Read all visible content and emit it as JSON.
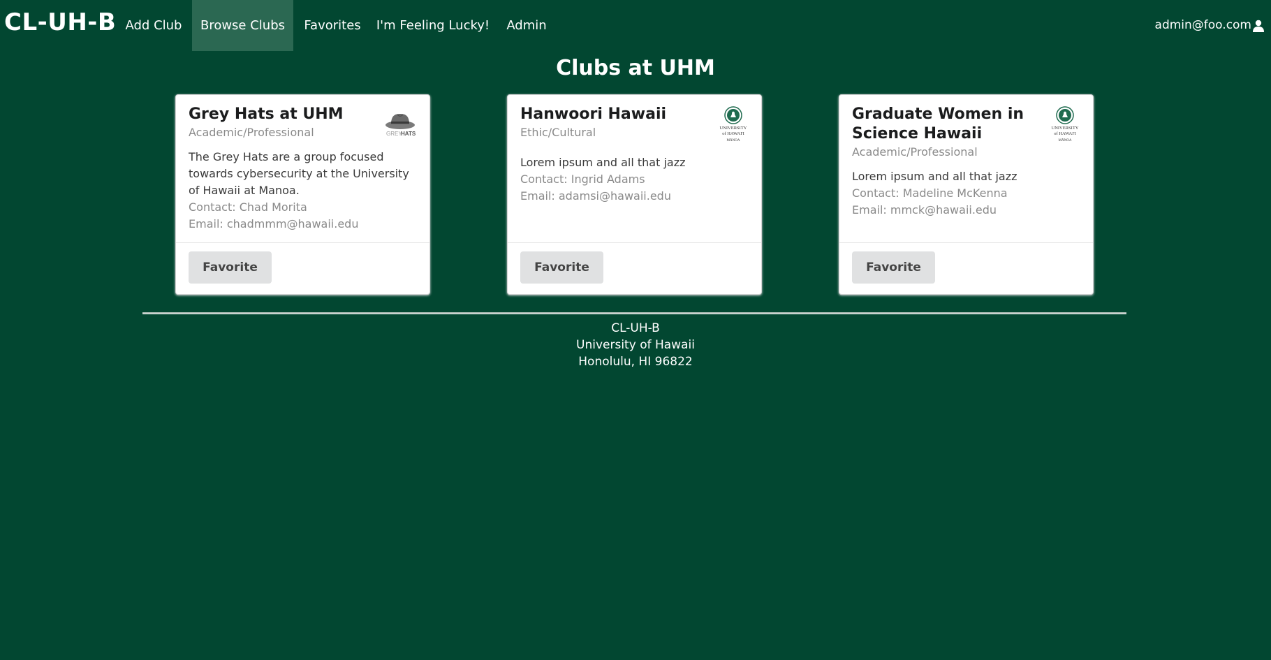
{
  "navbar": {
    "brand": "CL-UH-B",
    "items": [
      {
        "label": "Add Club"
      },
      {
        "label": "Browse Clubs"
      },
      {
        "label": "Favorites"
      },
      {
        "label": "I'm Feeling Lucky!"
      },
      {
        "label": "Admin"
      }
    ],
    "active_item": "Browse Clubs",
    "user_email": "admin@foo.com",
    "user_icon": "user-icon"
  },
  "page": {
    "title": "Clubs at UHM"
  },
  "clubs": [
    {
      "name": "Grey Hats at UHM",
      "type": "Academic/Professional",
      "description": "The Grey Hats are a group focused towards cybersecurity at the University of Hawaii at Manoa.",
      "contact": "Contact: Chad Morita",
      "email": "Email: chadmmm@hawaii.edu",
      "logo": "grey-hats-logo",
      "logo_text_grey": "GREY",
      "logo_text_hats": "HATS",
      "button_label": "Favorite"
    },
    {
      "name": "Hanwoori Hawaii",
      "type": "Ethic/Cultural",
      "description": "Lorem ipsum and all that jazz",
      "contact": "Contact: Ingrid Adams",
      "email": "Email: adamsi@hawaii.edu",
      "logo": "uh-manoa-logo",
      "logo_lines": [
        "UNIVERSITY",
        "of HAWAI'I",
        "MĀNOA"
      ],
      "button_label": "Favorite"
    },
    {
      "name": "Graduate Women in Science Hawaii",
      "type": "Academic/Professional",
      "description": "Lorem ipsum and all that jazz",
      "contact": "Contact: Madeline McKenna",
      "email": "Email: mmck@hawaii.edu",
      "logo": "uh-manoa-logo",
      "logo_lines": [
        "UNIVERSITY",
        "of HAWAI'I",
        "MĀNOA"
      ],
      "button_label": "Favorite"
    }
  ],
  "footer": {
    "line1": "CL-UH-B",
    "line2": "University of Hawaii",
    "line3": "Honolulu, HI 96822"
  },
  "colors": {
    "background": "#024731",
    "nav_active": "#2b6852",
    "card_bg": "#ffffff",
    "button_bg": "#e0e1e2"
  }
}
